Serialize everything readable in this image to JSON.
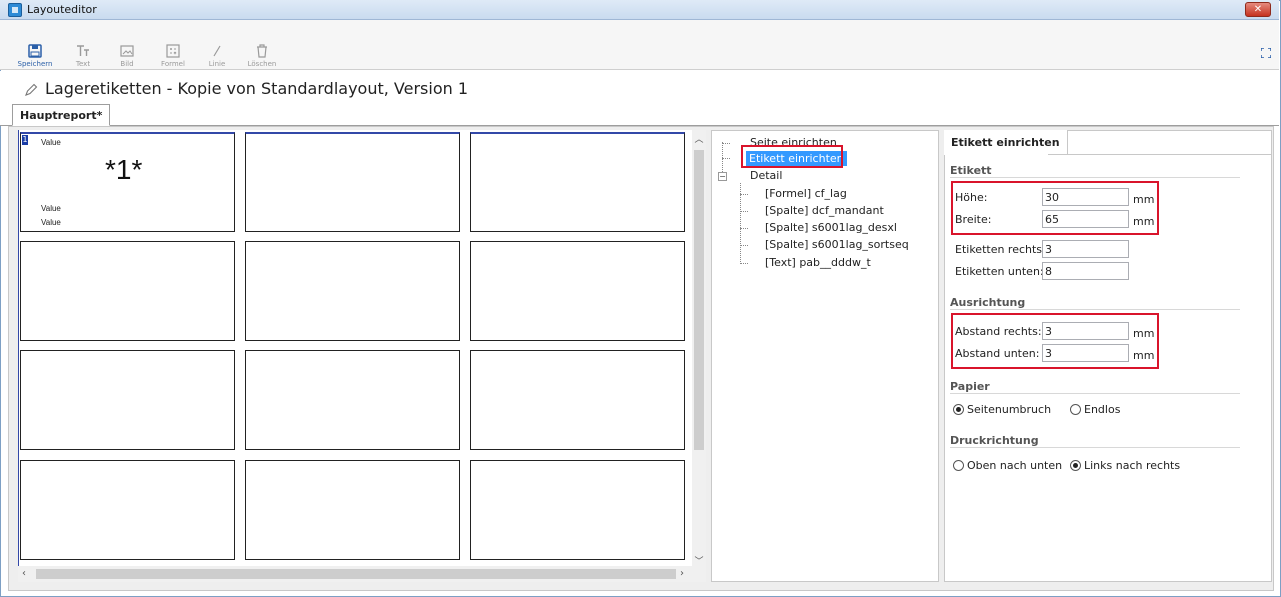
{
  "window": {
    "title": "Layouteditor",
    "close_label": "✕"
  },
  "toolbar": {
    "save": "Speichern",
    "text": "Text",
    "image": "Bild",
    "formula": "Formel",
    "line": "Linie",
    "delete": "Löschen"
  },
  "report": {
    "title": "Lageretiketten - Kopie von Standardlayout, Version 1"
  },
  "tabs": {
    "main": "Hauptreport*"
  },
  "grid": {
    "first_cell": {
      "number": "1",
      "value_top": "Value",
      "big": "*1*",
      "value_1": "Value",
      "value_2": "Value"
    }
  },
  "tree": {
    "items": [
      "Seite einrichten",
      "Etikett einrichten",
      "Detail",
      "[Formel] cf_lag",
      "[Spalte] dcf_mandant",
      "[Spalte] s6001lag_desxl",
      "[Spalte] s6001lag_sortseq",
      "[Text] pab__dddw_t"
    ],
    "expander": "−"
  },
  "props": {
    "tab": "Etikett einrichten",
    "etikett": {
      "heading": "Etikett",
      "hoehe_label": "Höhe:",
      "hoehe": "30",
      "breite_label": "Breite:",
      "breite": "65",
      "rechts_label": "Etiketten rechts:",
      "rechts": "3",
      "unten_label": "Etiketten unten:",
      "unten": "8",
      "unit": "mm"
    },
    "ausrichtung": {
      "heading": "Ausrichtung",
      "abstand_rechts_label": "Abstand rechts:",
      "abstand_rechts": "3",
      "abstand_unten_label": "Abstand unten:",
      "abstand_unten": "3",
      "unit": "mm"
    },
    "papier": {
      "heading": "Papier",
      "opt1": "Seitenumbruch",
      "opt2": "Endlos"
    },
    "druck": {
      "heading": "Druckrichtung",
      "opt1": "Oben nach unten",
      "opt2": "Links nach rechts"
    }
  }
}
